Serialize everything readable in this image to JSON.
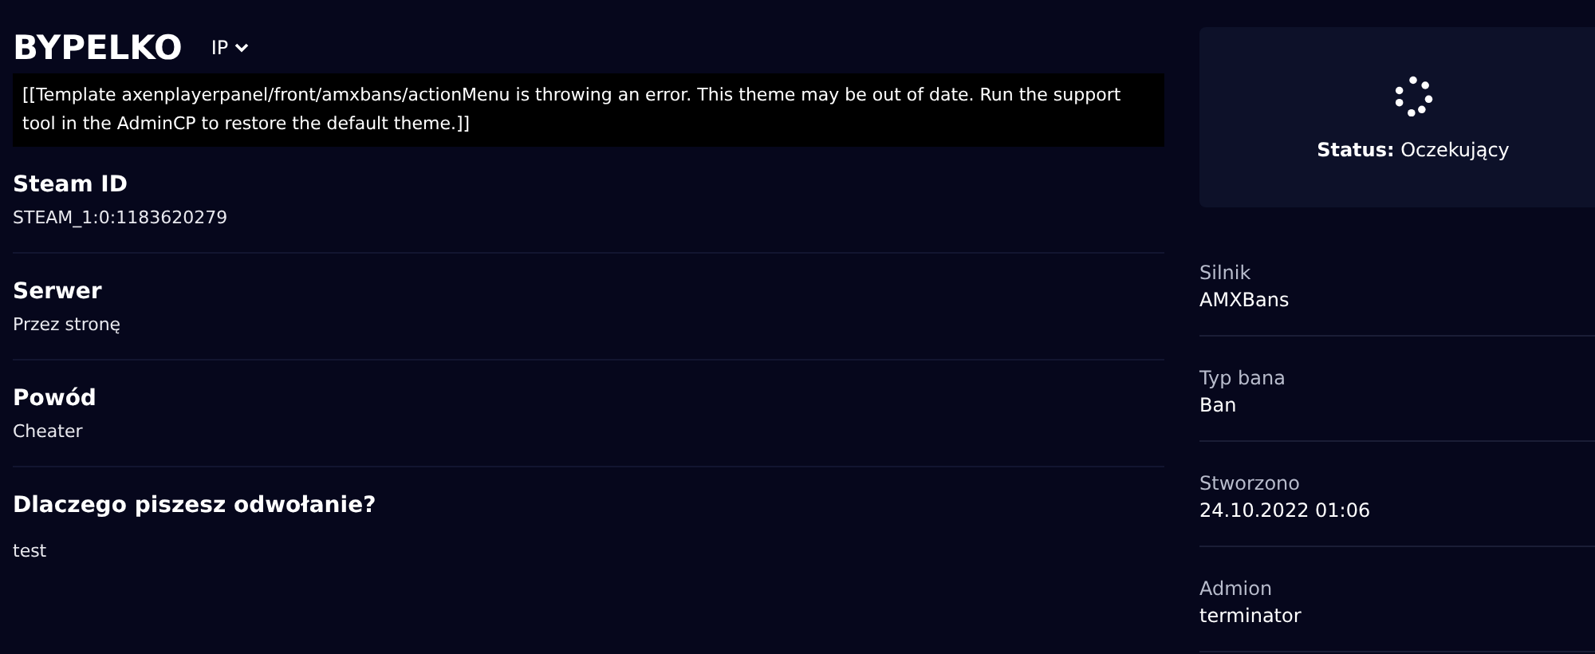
{
  "header": {
    "title": "BYPELKO",
    "dropdown": "IP"
  },
  "error_message": "[[Template axenplayerpanel/front/amxbans/actionMenu is throwing an error. This theme may be out of date. Run the support tool in the AdminCP to restore the default theme.]]",
  "details": [
    {
      "label": "Steam ID",
      "value": "STEAM_1:0:1183620279"
    },
    {
      "label": "Serwer",
      "value": "Przez stronę"
    },
    {
      "label": "Powód",
      "value": "Cheater"
    },
    {
      "label": "Dlaczego piszesz odwołanie?",
      "value": "test"
    }
  ],
  "status_card": {
    "text": "**Status:** Oczekujący"
  },
  "info": [
    {
      "label": "Silnik",
      "value": "AMXBans"
    },
    {
      "label": "Typ bana",
      "value": "Ban"
    },
    {
      "label": "Stworzono",
      "value": "24.10.2022 01:06"
    },
    {
      "label": "Admion",
      "value": "terminator"
    }
  ]
}
